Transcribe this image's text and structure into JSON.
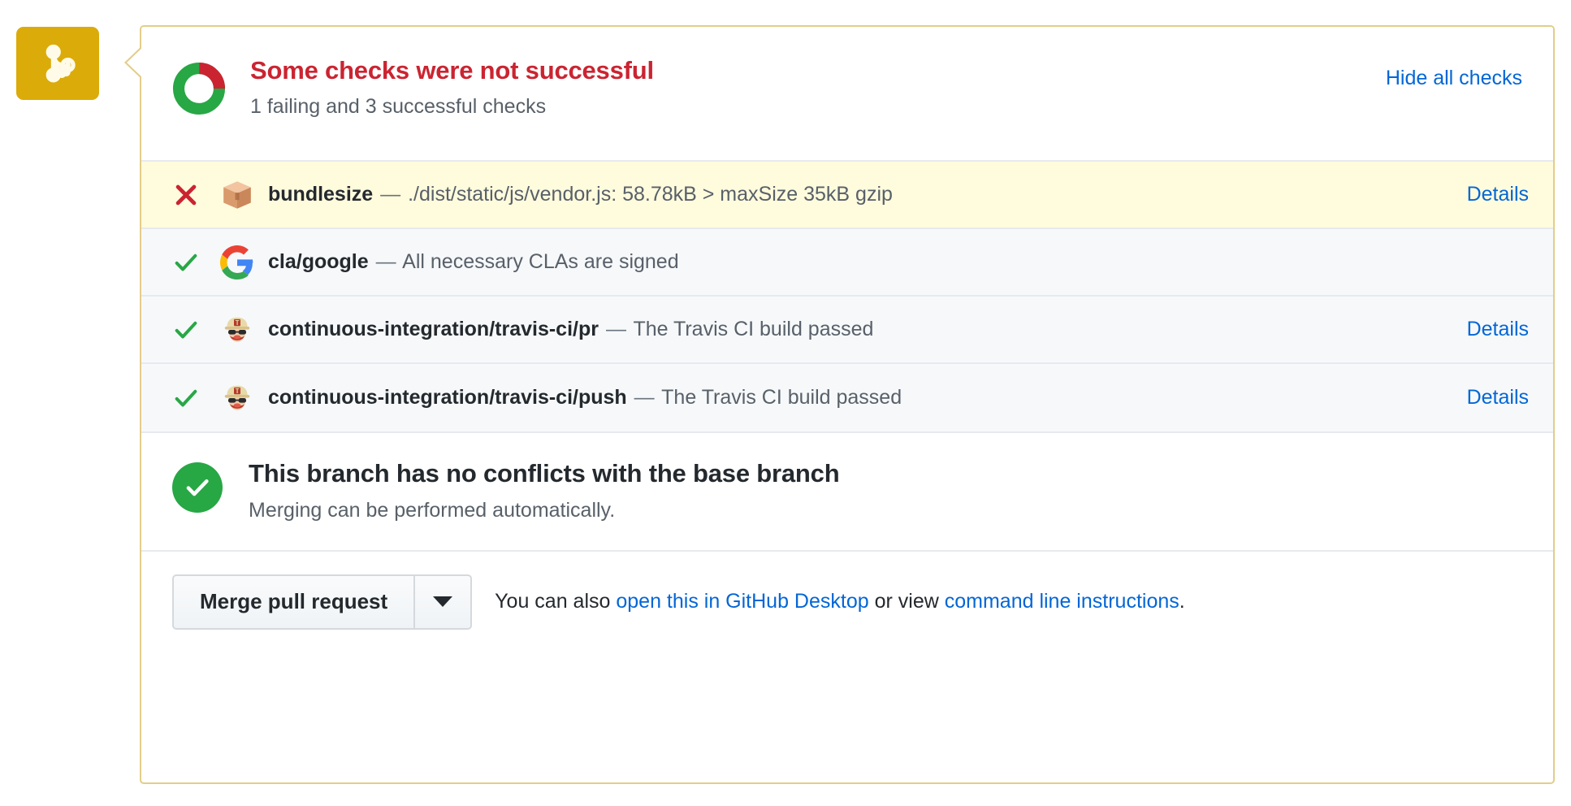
{
  "merge_badge": {
    "icon": "git-merge-icon",
    "color": "#dbab09"
  },
  "header": {
    "title": "Some checks were not successful",
    "subtitle": "1 failing and 3 successful checks",
    "hide_all_label": "Hide all checks",
    "title_color": "#cb2431",
    "donut": {
      "failing": 1,
      "successful": 3,
      "success_color": "#28a745",
      "failure_color": "#cb2431"
    }
  },
  "checks": [
    {
      "status": "failure",
      "status_icon": "x-icon",
      "avatar": "package-emoji",
      "name": "bundlesize",
      "dash": "—",
      "description": "./dist/static/js/vendor.js: 58.78kB > maxSize 35kB gzip",
      "details_label": "Details",
      "has_details": true,
      "highlight": true
    },
    {
      "status": "success",
      "status_icon": "check-icon",
      "avatar": "google-logo",
      "name": "cla/google",
      "dash": "—",
      "description": "All necessary CLAs are signed",
      "details_label": "",
      "has_details": false,
      "highlight": false
    },
    {
      "status": "success",
      "status_icon": "check-icon",
      "avatar": "travis-ci-logo",
      "name": "continuous-integration/travis-ci/pr",
      "dash": "—",
      "description": "The Travis CI build passed",
      "details_label": "Details",
      "has_details": true,
      "highlight": false
    },
    {
      "status": "success",
      "status_icon": "check-icon",
      "avatar": "travis-ci-logo",
      "name": "continuous-integration/travis-ci/push",
      "dash": "—",
      "description": "The Travis CI build passed",
      "details_label": "Details",
      "has_details": true,
      "highlight": false
    }
  ],
  "conflict": {
    "icon": "check-circle-icon",
    "icon_color": "#28a745",
    "title": "This branch has no conflicts with the base branch",
    "subtitle": "Merging can be performed automatically."
  },
  "merge_footer": {
    "merge_button_label": "Merge pull request",
    "dropdown_icon": "chevron-down-icon",
    "note_prefix": "You can also ",
    "desktop_link": "open this in GitHub Desktop",
    "note_middle": " or view ",
    "cli_link": "command line instructions",
    "note_suffix": "."
  }
}
